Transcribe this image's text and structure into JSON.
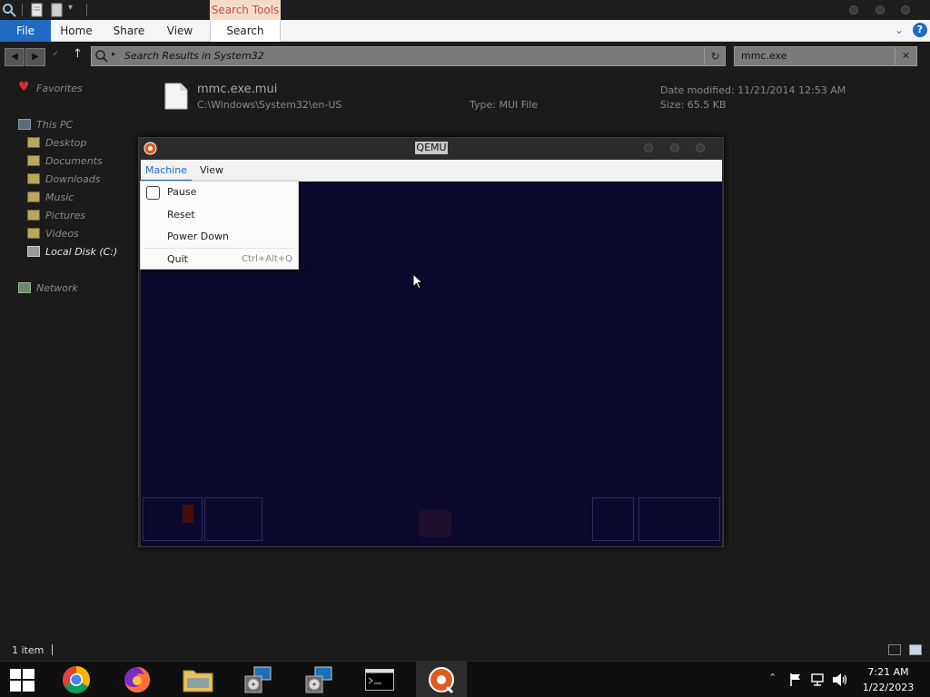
{
  "ribbon": {
    "context_tab": "Search Tools",
    "tabs": [
      "File",
      "Home",
      "Share",
      "View",
      "Search"
    ]
  },
  "address": {
    "path": "Search Results in System32",
    "search_value": "mmc.exe"
  },
  "sidebar": {
    "favorites": "Favorites",
    "this_pc": "This PC",
    "items": [
      "Desktop",
      "Documents",
      "Downloads",
      "Music",
      "Pictures",
      "Videos",
      "Local Disk (C:)"
    ],
    "network": "Network"
  },
  "result": {
    "name": "mmc.exe.mui",
    "path": "C:\\Windows\\System32\\en-US",
    "type": "Type: MUI File",
    "date_modified": "Date modified: 11/21/2014 12:53 AM",
    "size": "Size: 65.5 KB"
  },
  "qemu": {
    "title": "QEMU",
    "menus": [
      "Machine",
      "View"
    ],
    "machine_menu": {
      "items": [
        {
          "label": "Pause",
          "shortcut": ""
        },
        {
          "label": "Reset",
          "shortcut": ""
        },
        {
          "label": "Power Down",
          "shortcut": ""
        },
        {
          "label": "Quit",
          "shortcut": "Ctrl+Alt+Q"
        }
      ]
    }
  },
  "status": {
    "item_count": "1 item"
  },
  "taskbar": {
    "time": "7:21 AM",
    "date": "1/22/2023"
  },
  "colors": {
    "accent": "#1f6bc1",
    "context_tab_bg": "#f6dcc8",
    "context_tab_text": "#c0504d",
    "qemu_screen": "#0b0a2e"
  }
}
